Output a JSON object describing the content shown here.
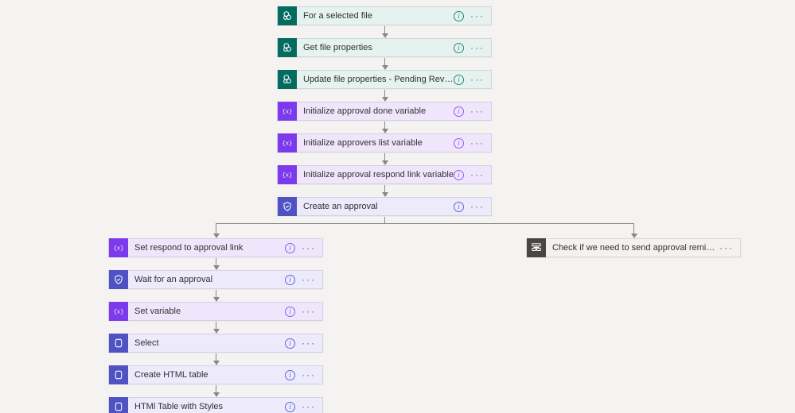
{
  "steps": {
    "for_selected_file": {
      "label": "For a selected file"
    },
    "get_file_props": {
      "label": "Get file properties"
    },
    "update_file_props": {
      "label": "Update file properties - Pending Review"
    },
    "init_done": {
      "label": "Initialize approval done variable"
    },
    "init_approvers": {
      "label": "Initialize approvers list variable"
    },
    "init_respond_link": {
      "label": "Initialize approval respond link variable"
    },
    "create_approval": {
      "label": "Create an approval"
    },
    "set_respond_link": {
      "label": "Set respond to approval link"
    },
    "wait_for_approval": {
      "label": "Wait for an approval"
    },
    "set_variable": {
      "label": "Set variable"
    },
    "select_op": {
      "label": "Select"
    },
    "create_html_table": {
      "label": "Create HTML table"
    },
    "html_table_styles": {
      "label": "HTMl Table with Styles"
    },
    "check_reminders": {
      "label": "Check if we need to send approval reminders"
    }
  }
}
